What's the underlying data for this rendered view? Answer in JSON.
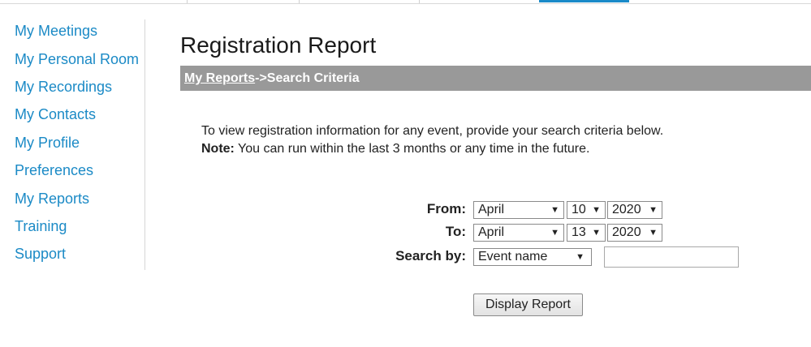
{
  "sidebar": {
    "items": [
      {
        "label": "My Meetings"
      },
      {
        "label": "My Personal Room"
      },
      {
        "label": "My Recordings"
      },
      {
        "label": "My Contacts"
      },
      {
        "label": "My Profile"
      },
      {
        "label": "Preferences"
      },
      {
        "label": "My Reports"
      },
      {
        "label": "Training"
      },
      {
        "label": "Support"
      }
    ]
  },
  "main": {
    "title": "Registration Report",
    "breadcrumb": {
      "link": "My Reports",
      "separator": "->",
      "current": "Search Criteria"
    },
    "intro_line1": "To view registration information for any event, provide your search criteria below.",
    "note_label": "Note:",
    "note_text": " You can run within the last 3 months or any time in the future."
  },
  "form": {
    "from_label": "From:",
    "to_label": "To:",
    "search_by_label": "Search by:",
    "from_month": "April",
    "from_day": "10",
    "from_year": "2020",
    "to_month": "April",
    "to_day": "13",
    "to_year": "2020",
    "search_by": "Event name",
    "search_value": "",
    "submit_label": "Display Report"
  },
  "icons": {
    "dropdown_arrow": "▼"
  },
  "colors": {
    "link": "#1b8ac6",
    "crumb_bar": "#999999",
    "active_tab": "#1a8ac8"
  }
}
